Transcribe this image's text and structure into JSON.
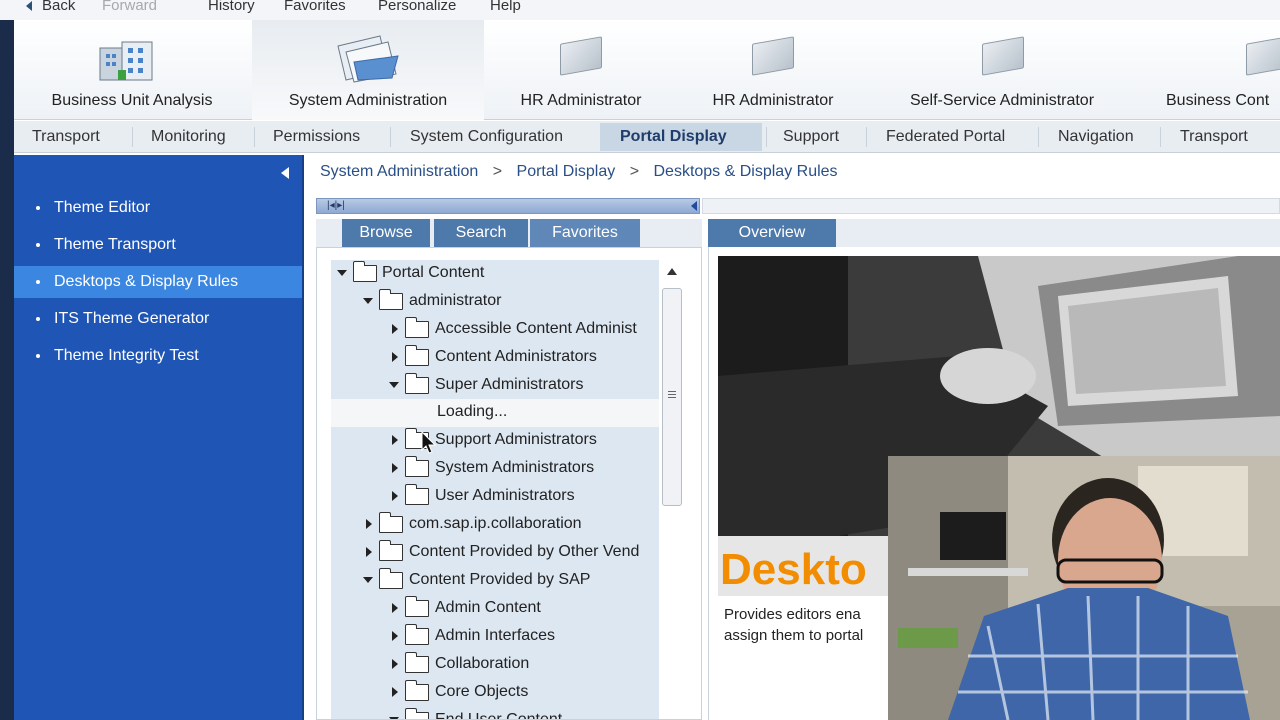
{
  "menubar": {
    "back": "Back",
    "forward": "Forward",
    "history": "History",
    "favorites": "Favorites",
    "personalize": "Personalize",
    "help": "Help"
  },
  "roles": [
    {
      "label": "Business Unit Analysis",
      "icon": "building-icon"
    },
    {
      "label": "System Administration",
      "icon": "papers-icon"
    },
    {
      "label": "HR Administrator",
      "icon": "folder-icon"
    },
    {
      "label": "HR Administrator",
      "icon": "folder-icon"
    },
    {
      "label": "Self-Service Administrator",
      "icon": "folder-icon"
    },
    {
      "label": "Business Cont",
      "icon": "folder-icon"
    }
  ],
  "subnav": [
    "Transport",
    "Monitoring",
    "Permissions",
    "System Configuration",
    "Portal Display",
    "Support",
    "Federated Portal",
    "Navigation",
    "Transport"
  ],
  "leftnav": [
    "Theme Editor",
    "Theme Transport",
    "Desktops & Display Rules",
    "ITS Theme Generator",
    "Theme Integrity Test"
  ],
  "breadcrumb": [
    "System Administration",
    ">",
    "Portal Display",
    ">",
    "Desktops & Display Rules"
  ],
  "panel_tabs": [
    "Browse",
    "Search",
    "Favorites"
  ],
  "tree": [
    {
      "label": "Portal Content",
      "state": "open"
    },
    {
      "label": "administrator",
      "state": "open"
    },
    {
      "label": "Accessible Content Administ",
      "state": "closed"
    },
    {
      "label": "Content Administrators",
      "state": "closed"
    },
    {
      "label": "Super Administrators",
      "state": "open"
    },
    {
      "label": "Loading...",
      "state": "none"
    },
    {
      "label": "Support Administrators",
      "state": "closed"
    },
    {
      "label": "System Administrators",
      "state": "closed"
    },
    {
      "label": "User Administrators",
      "state": "closed"
    },
    {
      "label": "com.sap.ip.collaboration",
      "state": "closed"
    },
    {
      "label": "Content Provided by Other Vend",
      "state": "closed"
    },
    {
      "label": "Content Provided by SAP",
      "state": "open"
    },
    {
      "label": "Admin Content",
      "state": "closed"
    },
    {
      "label": "Admin Interfaces",
      "state": "closed"
    },
    {
      "label": "Collaboration",
      "state": "closed"
    },
    {
      "label": "Core Objects",
      "state": "closed"
    },
    {
      "label": "End User Content",
      "state": "open"
    }
  ],
  "overview": {
    "tab": "Overview",
    "title": "Deskto",
    "desc_line1": "Provides editors ena",
    "desc_line2": "assign them to portal"
  },
  "colors": {
    "nav_bg": "#1f55b5",
    "nav_sel": "#3a86e0",
    "tab": "#4d79ab",
    "accent": "#f28c00"
  }
}
